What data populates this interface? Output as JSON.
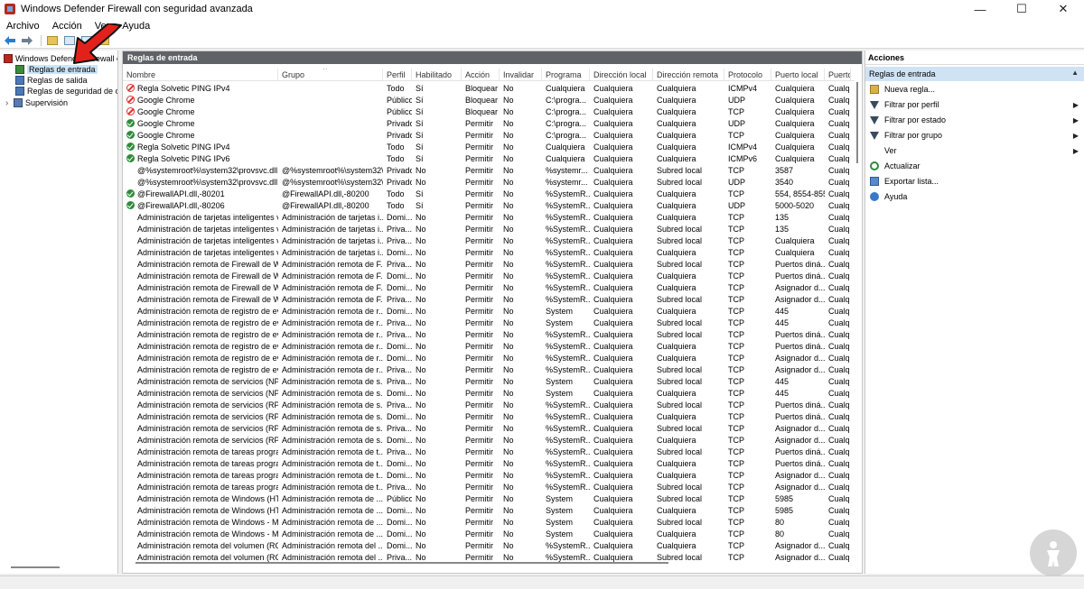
{
  "window": {
    "title": "Windows Defender Firewall con seguridad avanzada",
    "minimize": "—",
    "maximize": "☐",
    "close": "✕"
  },
  "menu": [
    "Archivo",
    "Acción",
    "Ver",
    "Ayuda"
  ],
  "tree": {
    "root": "Windows Defender Firewall con",
    "items": [
      "Reglas de entrada",
      "Reglas de salida",
      "Reglas de seguridad de con",
      "Supervisión"
    ],
    "expander": "›"
  },
  "center": {
    "header": "Reglas de entrada",
    "columns": [
      "Nombre",
      "Grupo",
      "Perfil",
      "Habilitado",
      "Acción",
      "Invalidar",
      "Programa",
      "Dirección local",
      "Dirección remota",
      "Protocolo",
      "Puerto local",
      "Puerto"
    ],
    "sort_glyph": "^",
    "rows": [
      {
        "status": "block",
        "cells": [
          "Regla Solvetic PING IPv4",
          "",
          "Todo",
          "Sí",
          "Bloquear",
          "No",
          "Cualquiera",
          "Cualquiera",
          "Cualquiera",
          "ICMPv4",
          "Cualquiera",
          "Cualq"
        ]
      },
      {
        "status": "block",
        "cells": [
          "Google Chrome",
          "",
          "Público",
          "Sí",
          "Bloquear",
          "No",
          "C:\\progra...",
          "Cualquiera",
          "Cualquiera",
          "UDP",
          "Cualquiera",
          "Cualq"
        ]
      },
      {
        "status": "block",
        "cells": [
          "Google Chrome",
          "",
          "Público",
          "Sí",
          "Bloquear",
          "No",
          "C:\\progra...",
          "Cualquiera",
          "Cualquiera",
          "TCP",
          "Cualquiera",
          "Cualq"
        ]
      },
      {
        "status": "ok",
        "cells": [
          "Google Chrome",
          "",
          "Privado",
          "Sí",
          "Permitir",
          "No",
          "C:\\progra...",
          "Cualquiera",
          "Cualquiera",
          "UDP",
          "Cualquiera",
          "Cualq"
        ]
      },
      {
        "status": "ok",
        "cells": [
          "Google Chrome",
          "",
          "Privado",
          "Sí",
          "Permitir",
          "No",
          "C:\\progra...",
          "Cualquiera",
          "Cualquiera",
          "TCP",
          "Cualquiera",
          "Cualq"
        ]
      },
      {
        "status": "ok",
        "cells": [
          "Regla Solvetic PING IPv4",
          "",
          "Todo",
          "Sí",
          "Permitir",
          "No",
          "Cualquiera",
          "Cualquiera",
          "Cualquiera",
          "ICMPv4",
          "Cualquiera",
          "Cualq"
        ]
      },
      {
        "status": "ok",
        "cells": [
          "Regla Solvetic PING IPv6",
          "",
          "Todo",
          "Sí",
          "Permitir",
          "No",
          "Cualquiera",
          "Cualquiera",
          "Cualquiera",
          "ICMPv6",
          "Cualquiera",
          "Cualq"
        ]
      },
      {
        "status": "none",
        "cells": [
          "@%systemroot%\\system32\\provsvc.dll,-...",
          "@%systemroot%\\system32\\...",
          "Privado",
          "No",
          "Permitir",
          "No",
          "%systemr...",
          "Cualquiera",
          "Subred local",
          "TCP",
          "3587",
          "Cualq"
        ]
      },
      {
        "status": "none",
        "cells": [
          "@%systemroot%\\system32\\provsvc.dll,-...",
          "@%systemroot%\\system32\\...",
          "Privado",
          "No",
          "Permitir",
          "No",
          "%systemr...",
          "Cualquiera",
          "Subred local",
          "UDP",
          "3540",
          "Cualq"
        ]
      },
      {
        "status": "ok",
        "cells": [
          "@FirewallAPI.dll,-80201",
          "@FirewallAPI.dll,-80200",
          "Todo",
          "Sí",
          "Permitir",
          "No",
          "%SystemR...",
          "Cualquiera",
          "Cualquiera",
          "TCP",
          "554, 8554-855...",
          "Cualq"
        ]
      },
      {
        "status": "ok",
        "cells": [
          "@FirewallAPI.dll,-80206",
          "@FirewallAPI.dll,-80200",
          "Todo",
          "Sí",
          "Permitir",
          "No",
          "%SystemR...",
          "Cualquiera",
          "Cualquiera",
          "UDP",
          "5000-5020",
          "Cualq"
        ]
      },
      {
        "status": "none",
        "cells": [
          "Administración de tarjetas inteligentes vi...",
          "Administración de tarjetas i...",
          "Domi...",
          "No",
          "Permitir",
          "No",
          "%SystemR...",
          "Cualquiera",
          "Cualquiera",
          "TCP",
          "135",
          "Cualq"
        ]
      },
      {
        "status": "none",
        "cells": [
          "Administración de tarjetas inteligentes vi...",
          "Administración de tarjetas i...",
          "Priva...",
          "No",
          "Permitir",
          "No",
          "%SystemR...",
          "Cualquiera",
          "Subred local",
          "TCP",
          "135",
          "Cualq"
        ]
      },
      {
        "status": "none",
        "cells": [
          "Administración de tarjetas inteligentes vi...",
          "Administración de tarjetas i...",
          "Priva...",
          "No",
          "Permitir",
          "No",
          "%SystemR...",
          "Cualquiera",
          "Subred local",
          "TCP",
          "Cualquiera",
          "Cualq"
        ]
      },
      {
        "status": "none",
        "cells": [
          "Administración de tarjetas inteligentes vi...",
          "Administración de tarjetas i...",
          "Domi...",
          "No",
          "Permitir",
          "No",
          "%SystemR...",
          "Cualquiera",
          "Cualquiera",
          "TCP",
          "Cualquiera",
          "Cualq"
        ]
      },
      {
        "status": "none",
        "cells": [
          "Administración remota de Firewall de Wi...",
          "Administración remota de F...",
          "Priva...",
          "No",
          "Permitir",
          "No",
          "%SystemR...",
          "Cualquiera",
          "Subred local",
          "TCP",
          "Puertos diná...",
          "Cualq"
        ]
      },
      {
        "status": "none",
        "cells": [
          "Administración remota de Firewall de Wi...",
          "Administración remota de F...",
          "Domi...",
          "No",
          "Permitir",
          "No",
          "%SystemR...",
          "Cualquiera",
          "Cualquiera",
          "TCP",
          "Puertos diná...",
          "Cualq"
        ]
      },
      {
        "status": "none",
        "cells": [
          "Administración remota de Firewall de Wi...",
          "Administración remota de F...",
          "Domi...",
          "No",
          "Permitir",
          "No",
          "%SystemR...",
          "Cualquiera",
          "Cualquiera",
          "TCP",
          "Asignador d...",
          "Cualq"
        ]
      },
      {
        "status": "none",
        "cells": [
          "Administración remota de Firewall de Wi...",
          "Administración remota de F...",
          "Priva...",
          "No",
          "Permitir",
          "No",
          "%SystemR...",
          "Cualquiera",
          "Subred local",
          "TCP",
          "Asignador d...",
          "Cualq"
        ]
      },
      {
        "status": "none",
        "cells": [
          "Administración remota de registro de ev...",
          "Administración remota de r...",
          "Domi...",
          "No",
          "Permitir",
          "No",
          "System",
          "Cualquiera",
          "Cualquiera",
          "TCP",
          "445",
          "Cualq"
        ]
      },
      {
        "status": "none",
        "cells": [
          "Administración remota de registro de ev...",
          "Administración remota de r...",
          "Priva...",
          "No",
          "Permitir",
          "No",
          "System",
          "Cualquiera",
          "Subred local",
          "TCP",
          "445",
          "Cualq"
        ]
      },
      {
        "status": "none",
        "cells": [
          "Administración remota de registro de ev...",
          "Administración remota de r...",
          "Priva...",
          "No",
          "Permitir",
          "No",
          "%SystemR...",
          "Cualquiera",
          "Subred local",
          "TCP",
          "Puertos diná...",
          "Cualq"
        ]
      },
      {
        "status": "none",
        "cells": [
          "Administración remota de registro de ev...",
          "Administración remota de r...",
          "Domi...",
          "No",
          "Permitir",
          "No",
          "%SystemR...",
          "Cualquiera",
          "Cualquiera",
          "TCP",
          "Puertos diná...",
          "Cualq"
        ]
      },
      {
        "status": "none",
        "cells": [
          "Administración remota de registro de ev...",
          "Administración remota de r...",
          "Domi...",
          "No",
          "Permitir",
          "No",
          "%SystemR...",
          "Cualquiera",
          "Cualquiera",
          "TCP",
          "Asignador d...",
          "Cualq"
        ]
      },
      {
        "status": "none",
        "cells": [
          "Administración remota de registro de ev...",
          "Administración remota de r...",
          "Priva...",
          "No",
          "Permitir",
          "No",
          "%SystemR...",
          "Cualquiera",
          "Subred local",
          "TCP",
          "Asignador d...",
          "Cualq"
        ]
      },
      {
        "status": "none",
        "cells": [
          "Administración remota de servicios (NP ...",
          "Administración remota de s...",
          "Priva...",
          "No",
          "Permitir",
          "No",
          "System",
          "Cualquiera",
          "Subred local",
          "TCP",
          "445",
          "Cualq"
        ]
      },
      {
        "status": "none",
        "cells": [
          "Administración remota de servicios (NP ...",
          "Administración remota de s...",
          "Domi...",
          "No",
          "Permitir",
          "No",
          "System",
          "Cualquiera",
          "Cualquiera",
          "TCP",
          "445",
          "Cualq"
        ]
      },
      {
        "status": "none",
        "cells": [
          "Administración remota de servicios (RPC)",
          "Administración remota de s...",
          "Priva...",
          "No",
          "Permitir",
          "No",
          "%SystemR...",
          "Cualquiera",
          "Subred local",
          "TCP",
          "Puertos diná...",
          "Cualq"
        ]
      },
      {
        "status": "none",
        "cells": [
          "Administración remota de servicios (RPC)",
          "Administración remota de s...",
          "Domi...",
          "No",
          "Permitir",
          "No",
          "%SystemR...",
          "Cualquiera",
          "Cualquiera",
          "TCP",
          "Puertos diná...",
          "Cualq"
        ]
      },
      {
        "status": "none",
        "cells": [
          "Administración remota de servicios (RPC)",
          "Administración remota de s...",
          "Priva...",
          "No",
          "Permitir",
          "No",
          "%SystemR...",
          "Cualquiera",
          "Subred local",
          "TCP",
          "Asignador d...",
          "Cualq"
        ]
      },
      {
        "status": "none",
        "cells": [
          "Administración remota de servicios (RPC)",
          "Administración remota de s...",
          "Domi...",
          "No",
          "Permitir",
          "No",
          "%SystemR...",
          "Cualquiera",
          "Cualquiera",
          "TCP",
          "Asignador d...",
          "Cualq"
        ]
      },
      {
        "status": "none",
        "cells": [
          "Administración remota de tareas progra...",
          "Administración remota de t...",
          "Priva...",
          "No",
          "Permitir",
          "No",
          "%SystemR...",
          "Cualquiera",
          "Subred local",
          "TCP",
          "Puertos diná...",
          "Cualq"
        ]
      },
      {
        "status": "none",
        "cells": [
          "Administración remota de tareas progra...",
          "Administración remota de t...",
          "Domi...",
          "No",
          "Permitir",
          "No",
          "%SystemR...",
          "Cualquiera",
          "Cualquiera",
          "TCP",
          "Puertos diná...",
          "Cualq"
        ]
      },
      {
        "status": "none",
        "cells": [
          "Administración remota de tareas progra...",
          "Administración remota de t...",
          "Domi...",
          "No",
          "Permitir",
          "No",
          "%SystemR...",
          "Cualquiera",
          "Cualquiera",
          "TCP",
          "Asignador d...",
          "Cualq"
        ]
      },
      {
        "status": "none",
        "cells": [
          "Administración remota de tareas progra...",
          "Administración remota de t...",
          "Priva...",
          "No",
          "Permitir",
          "No",
          "%SystemR...",
          "Cualquiera",
          "Subred local",
          "TCP",
          "Asignador d...",
          "Cualq"
        ]
      },
      {
        "status": "none",
        "cells": [
          "Administración remota de Windows (HT...",
          "Administración remota de ...",
          "Público",
          "No",
          "Permitir",
          "No",
          "System",
          "Cualquiera",
          "Subred local",
          "TCP",
          "5985",
          "Cualq"
        ]
      },
      {
        "status": "none",
        "cells": [
          "Administración remota de Windows (HT...",
          "Administración remota de ...",
          "Domi...",
          "No",
          "Permitir",
          "No",
          "System",
          "Cualquiera",
          "Cualquiera",
          "TCP",
          "5985",
          "Cualq"
        ]
      },
      {
        "status": "none",
        "cells": [
          "Administración remota de Windows - M...",
          "Administración remota de ...",
          "Domi...",
          "No",
          "Permitir",
          "No",
          "System",
          "Cualquiera",
          "Subred local",
          "TCP",
          "80",
          "Cualq"
        ]
      },
      {
        "status": "none",
        "cells": [
          "Administración remota de Windows - M...",
          "Administración remota de ...",
          "Domi...",
          "No",
          "Permitir",
          "No",
          "System",
          "Cualquiera",
          "Cualquiera",
          "TCP",
          "80",
          "Cualq"
        ]
      },
      {
        "status": "none",
        "cells": [
          "Administración remota del volumen (RC...",
          "Administración remota del ...",
          "Domi...",
          "No",
          "Permitir",
          "No",
          "%SystemR...",
          "Cualquiera",
          "Cualquiera",
          "TCP",
          "Asignador d...",
          "Cualq"
        ]
      },
      {
        "status": "none",
        "cells": [
          "Administración remota del volumen (RC...",
          "Administración remota del ...",
          "Priva...",
          "No",
          "Permitir",
          "No",
          "%SystemR...",
          "Cualquiera",
          "Subred local",
          "TCP",
          "Asignador d...",
          "Cualq"
        ]
      }
    ]
  },
  "actions": {
    "title": "Acciones",
    "section": "Reglas de entrada",
    "section_caret": "▲",
    "submenu_glyph": "▶",
    "items": [
      {
        "label": "Nueva regla...",
        "icon": "new-rule-icon",
        "sub": false
      },
      {
        "label": "Filtrar por perfil",
        "icon": "filter-icon",
        "sub": true
      },
      {
        "label": "Filtrar por estado",
        "icon": "filter-icon",
        "sub": true
      },
      {
        "label": "Filtrar por grupo",
        "icon": "filter-icon",
        "sub": true
      },
      {
        "label": "Ver",
        "icon": "",
        "sub": true
      },
      {
        "label": "Actualizar",
        "icon": "refresh-icon",
        "sub": false
      },
      {
        "label": "Exportar lista...",
        "icon": "export-icon",
        "sub": false
      },
      {
        "label": "Ayuda",
        "icon": "help-icon",
        "sub": false
      }
    ]
  },
  "colors": {
    "accent_red_arrow": "#e3211c",
    "center_header_bg": "#5f6367",
    "selection_bg": "#cce4f7"
  }
}
